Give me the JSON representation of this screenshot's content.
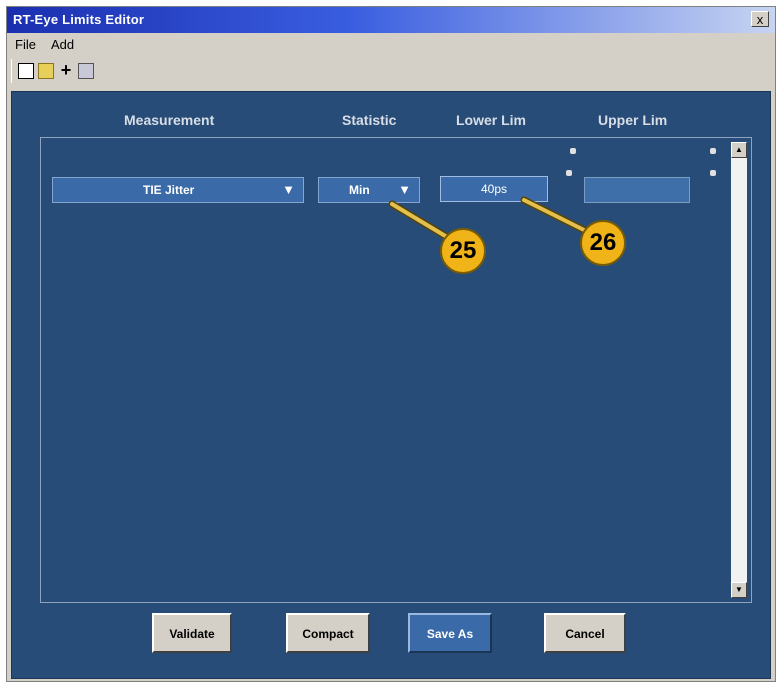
{
  "window": {
    "title": "RT-Eye Limits Editor",
    "close_glyph": "x"
  },
  "menu": {
    "items": [
      "File",
      "Add"
    ]
  },
  "columns": {
    "measurement": "Measurement",
    "statistic": "Statistic",
    "lower": "Lower Lim",
    "upper": "Upper Lim"
  },
  "row": {
    "measurement": "TIE Jitter",
    "statistic": "Min",
    "lower": "40ps",
    "upper": ""
  },
  "callouts": [
    "25",
    "26"
  ],
  "buttons": {
    "validate": "Validate",
    "compact": "Compact",
    "save_as": "Save As",
    "cancel": "Cancel"
  }
}
